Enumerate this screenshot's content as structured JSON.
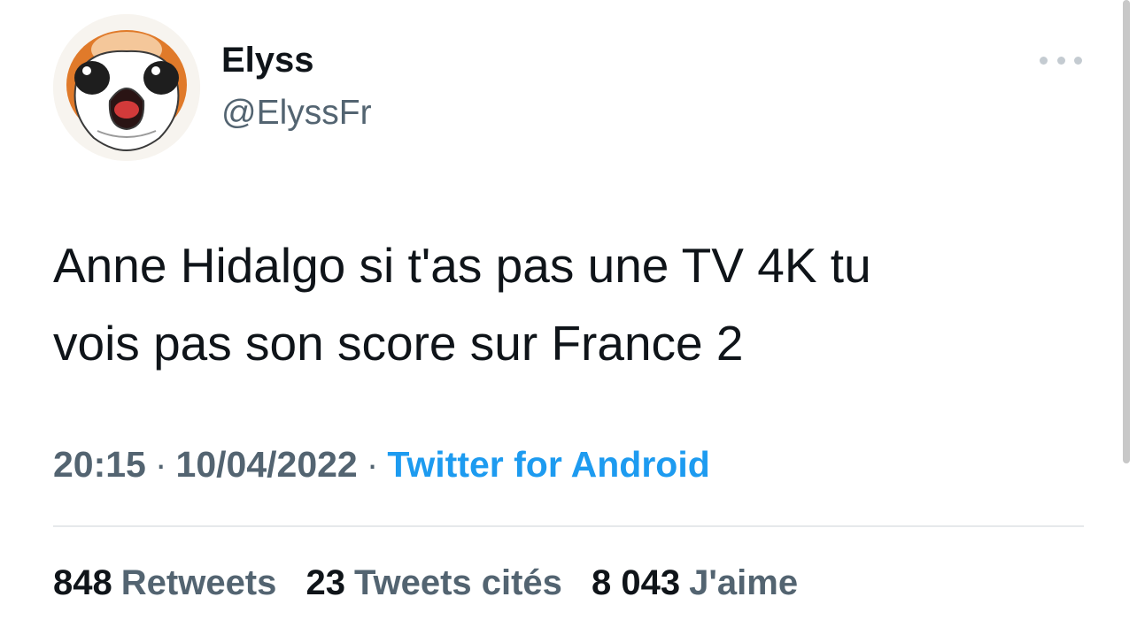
{
  "author": {
    "name": "Elyss",
    "handle": "@ElyssFr",
    "avatar_icon": "porg-avatar-icon"
  },
  "tweet": {
    "text": "Anne Hidalgo si t'as pas une TV 4K tu\nvois pas son score sur France 2"
  },
  "meta": {
    "time": "20:15",
    "separator": "·",
    "date": "10/04/2022",
    "source": "Twitter for Android"
  },
  "stats": {
    "retweets_count": "848",
    "retweets_label": "Retweets",
    "quotes_count": "23",
    "quotes_label": "Tweets cités",
    "likes_count": "8 043",
    "likes_label": "J'aime"
  },
  "icons": {
    "more": "more-options-icon"
  },
  "colors": {
    "text_primary": "#0f1419",
    "text_secondary": "#536471",
    "link": "#1d9bf0",
    "divider": "#e6e9eb"
  }
}
